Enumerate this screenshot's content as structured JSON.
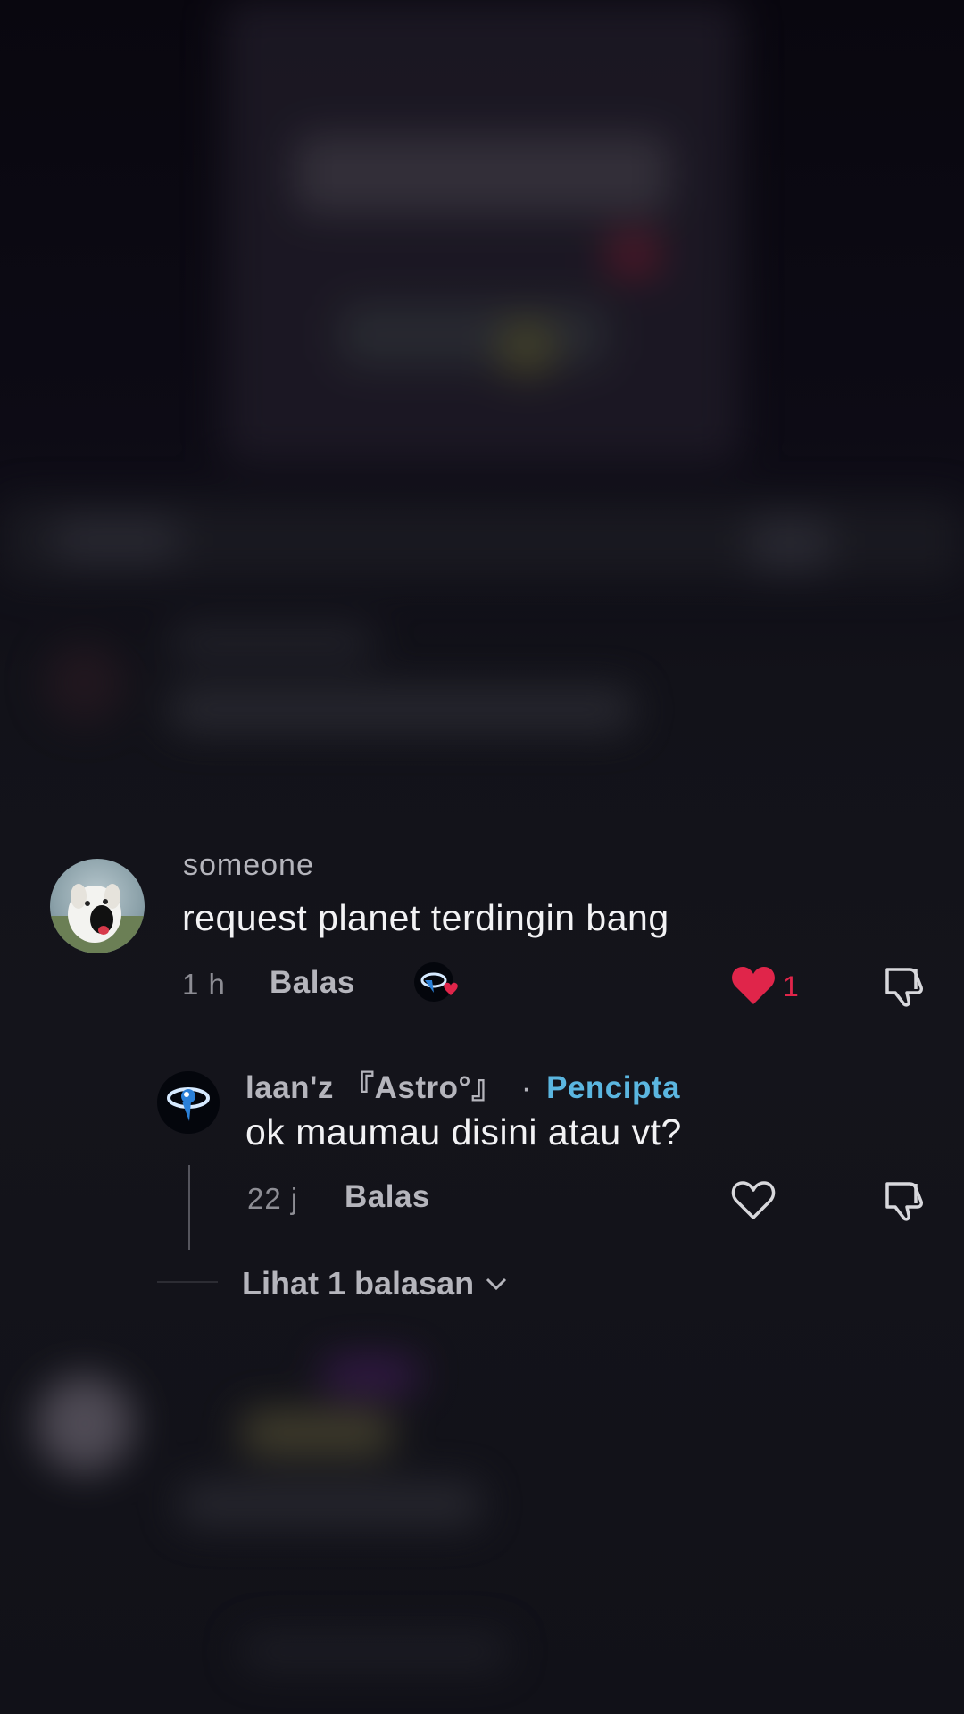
{
  "comment": {
    "username": "someone",
    "text": "request planet terdingin bang",
    "time": "1 h",
    "reply_label": "Balas",
    "like_count": "1",
    "liked": true,
    "colors": {
      "like": "#e0254a",
      "creator": "#5bb6e0"
    }
  },
  "reply": {
    "username": "laan'z 『Astro°』",
    "separator": "·",
    "creator_label": "Pencipta",
    "text": "ok maumau disini atau vt?",
    "time": "22 j",
    "reply_label": "Balas"
  },
  "view_replies": {
    "label": "Lihat 1 balasan",
    "icon": "chevron-down-icon"
  },
  "icons": {
    "like": "heart-icon",
    "dislike": "thumbs-down-icon",
    "creator_liked": "creator-liked-badge-icon"
  }
}
